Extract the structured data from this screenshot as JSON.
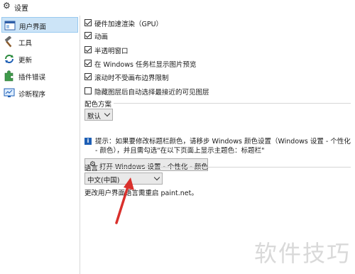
{
  "window": {
    "title": "设置"
  },
  "sidebar": {
    "items": [
      {
        "label": "用户界面",
        "icon": "window-icon",
        "selected": true
      },
      {
        "label": "工具",
        "icon": "hammer-icon",
        "selected": false
      },
      {
        "label": "更新",
        "icon": "refresh-icon",
        "selected": false
      },
      {
        "label": "插件错误",
        "icon": "puzzle-icon",
        "selected": false
      },
      {
        "label": "诊断程序",
        "icon": "monitor-icon",
        "selected": false
      }
    ]
  },
  "options": [
    {
      "label": "硬件加速渲染（GPU）",
      "checked": true
    },
    {
      "label": "动画",
      "checked": true
    },
    {
      "label": "半透明窗口",
      "checked": true
    },
    {
      "label": "在 Windows 任务栏显示图片预览",
      "checked": true
    },
    {
      "label": "滚动时不受画布边界限制",
      "checked": true
    },
    {
      "label": "隐藏图层后自动选择最接近的可见图层",
      "checked": false
    }
  ],
  "color_scheme": {
    "section_label": "配色方案",
    "selected": "默认",
    "info_text": "提示：如果要修改标题栏颜色，请移步 Windows 颜色设置（Windows 设置 - 个性化 - 颜色），并且需勾选\"在以下页面上显示主题色：标题栏\"",
    "button_label": "打开 Windows 设置 - 个性化 - 颜色"
  },
  "language": {
    "section_label": "语言",
    "selected": "中文(中国)",
    "note": "更改用户界面语言需重启 paint.net。"
  },
  "watermark": "软件技巧",
  "colors": {
    "selection_bg": "#cce4f7",
    "info_icon": "#1e5fb5",
    "arrow": "#d9302c"
  }
}
